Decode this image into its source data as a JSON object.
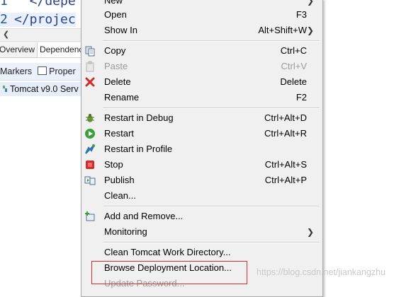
{
  "editor": {
    "lines": [
      {
        "number": "1",
        "text": "  </depe"
      },
      {
        "number": "2",
        "text": "</projec"
      }
    ]
  },
  "editor_tabs": [
    "Overview",
    "Dependencies"
  ],
  "views": {
    "tabs": [
      {
        "label": "Markers",
        "icon": "markers-icon"
      },
      {
        "label": "Proper",
        "icon": "properties-icon"
      }
    ]
  },
  "servers": {
    "row_label": "Tomcat v9.0 Serv"
  },
  "context_menu": {
    "items": [
      {
        "label": "New",
        "accel": "",
        "submenu": true,
        "enabled": true,
        "icon": "new-icon"
      },
      {
        "label": "Open",
        "accel": "F3",
        "submenu": false,
        "enabled": true,
        "icon": ""
      },
      {
        "label": "Show In",
        "accel": "Alt+Shift+W",
        "submenu": true,
        "enabled": true,
        "icon": ""
      },
      {
        "label": "Copy",
        "accel": "Ctrl+C",
        "submenu": false,
        "enabled": true,
        "icon": "copy-icon"
      },
      {
        "label": "Paste",
        "accel": "Ctrl+V",
        "submenu": false,
        "enabled": false,
        "icon": "paste-icon"
      },
      {
        "label": "Delete",
        "accel": "Delete",
        "submenu": false,
        "enabled": true,
        "icon": "delete-icon"
      },
      {
        "label": "Rename",
        "accel": "F2",
        "submenu": false,
        "enabled": true,
        "icon": ""
      },
      {
        "label": "Restart in Debug",
        "accel": "Ctrl+Alt+D",
        "submenu": false,
        "enabled": true,
        "icon": "debug-icon"
      },
      {
        "label": "Restart",
        "accel": "Ctrl+Alt+R",
        "submenu": false,
        "enabled": true,
        "icon": "restart-icon"
      },
      {
        "label": "Restart in Profile",
        "accel": "",
        "submenu": false,
        "enabled": true,
        "icon": "profile-icon"
      },
      {
        "label": "Stop",
        "accel": "Ctrl+Alt+S",
        "submenu": false,
        "enabled": true,
        "icon": "stop-icon"
      },
      {
        "label": "Publish",
        "accel": "Ctrl+Alt+P",
        "submenu": false,
        "enabled": true,
        "icon": "publish-icon"
      },
      {
        "label": "Clean...",
        "accel": "",
        "submenu": false,
        "enabled": true,
        "icon": ""
      },
      {
        "label": "Add and Remove...",
        "accel": "",
        "submenu": false,
        "enabled": true,
        "icon": "add-remove-icon"
      },
      {
        "label": "Monitoring",
        "accel": "",
        "submenu": true,
        "enabled": true,
        "icon": ""
      },
      {
        "label": "Clean Tomcat Work Directory...",
        "accel": "",
        "submenu": false,
        "enabled": true,
        "icon": ""
      },
      {
        "label": "Browse Deployment Location...",
        "accel": "",
        "submenu": false,
        "enabled": true,
        "icon": ""
      },
      {
        "label": "Update Password...",
        "accel": "",
        "submenu": false,
        "enabled": false,
        "icon": ""
      }
    ]
  },
  "watermark": "https://blog.csdn.net/jiankangzhu",
  "colors": {
    "menu_bg": "#f0f0f0",
    "highlight_border": "#d32f2f",
    "disabled_text": "#9a9a9a",
    "xml_tag": "#2b3f8f"
  }
}
